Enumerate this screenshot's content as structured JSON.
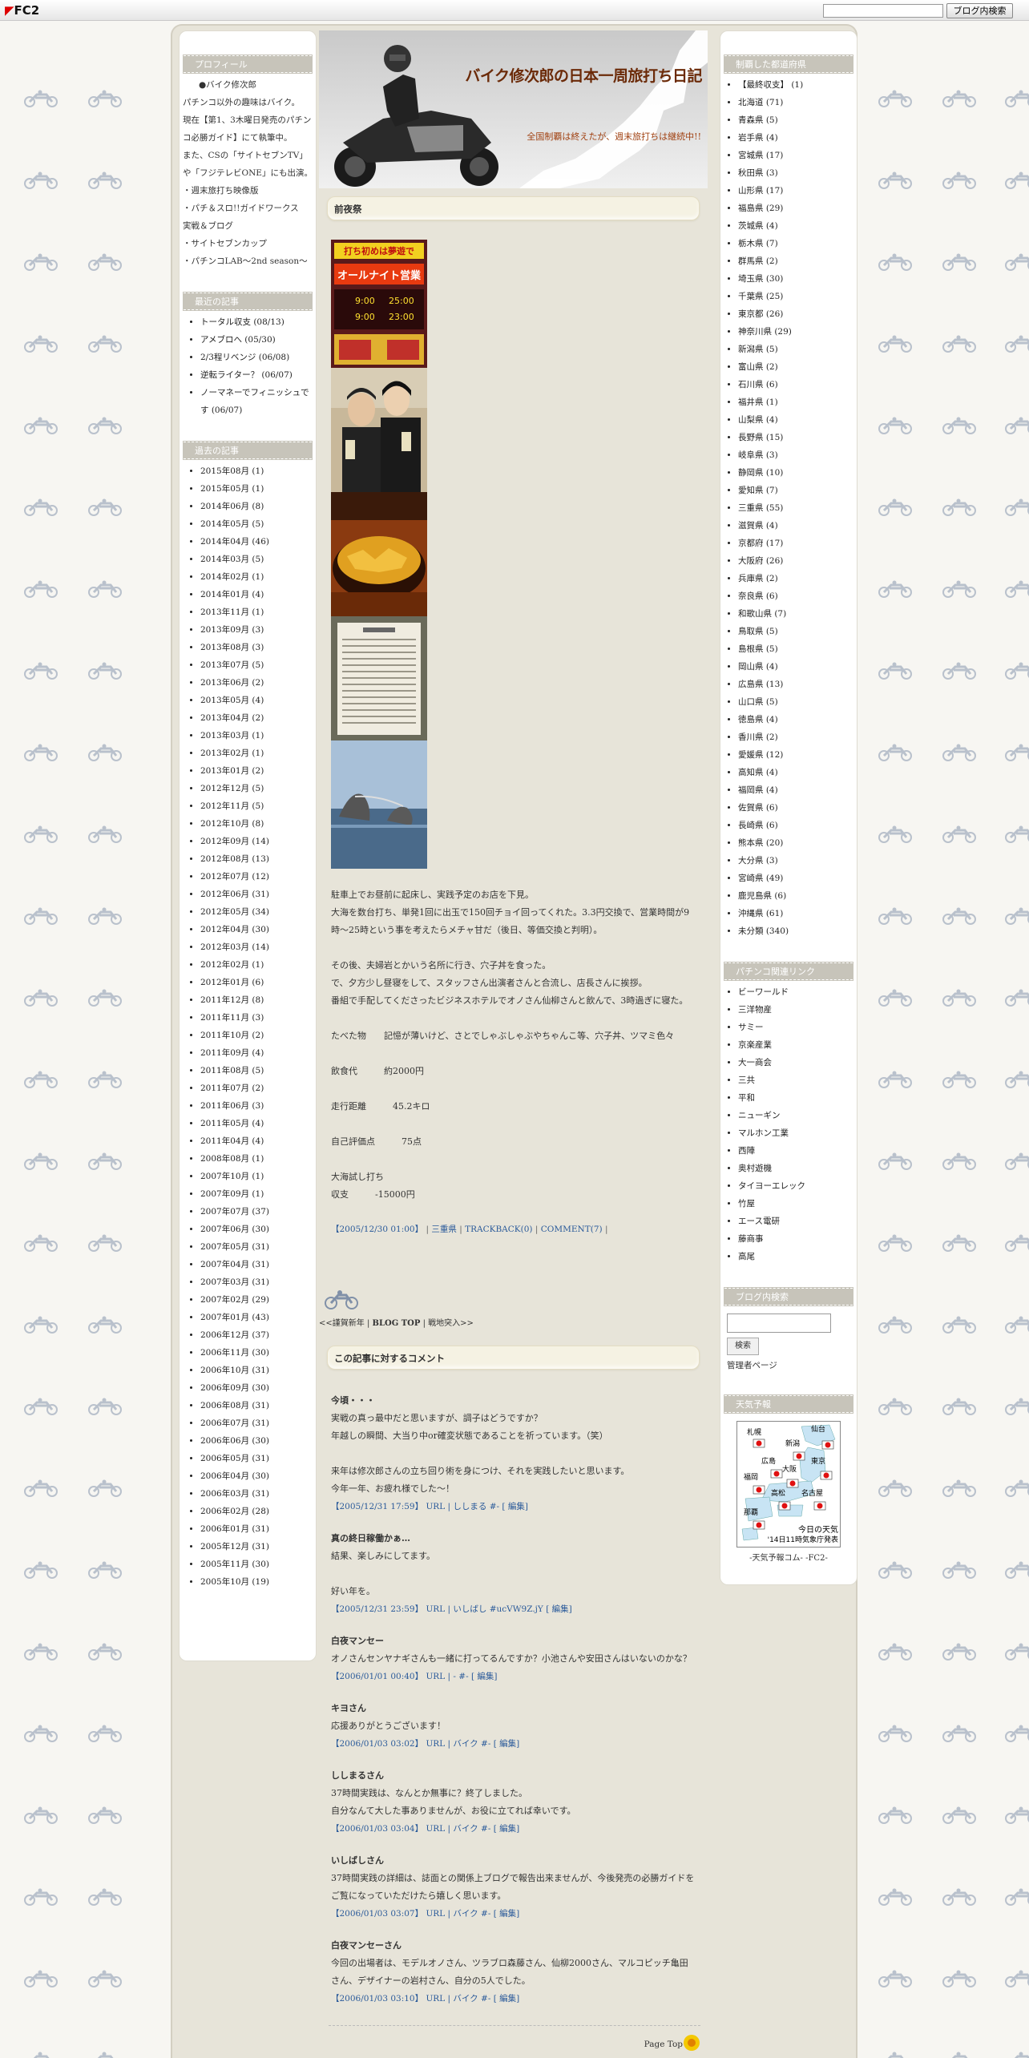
{
  "fc2bar": {
    "logo": "FC2",
    "search_button": "ブログ内検索"
  },
  "banner": {
    "title": "バイク修次郎の日本一周旅打ち日記",
    "subtitle": "全国制覇は終えたが、週末旅打ちは継続中!!"
  },
  "profile": {
    "heading": "プロフィール",
    "name": "●バイク修次郎",
    "lines": [
      "パチンコ以外の趣味はバイク。",
      "現在【第1、3木曜日発売のパチンコ必勝ガイド】にて執筆中。",
      "また、CSの「サイトセブンTV」や「フジテレビONE」にも出演。",
      "・週末旅打ち映像版",
      "・パチ＆スロ!!ガイドワークス　実戦＆ブログ",
      "・サイトセブンカップ",
      "・パチンコLAB～2nd season～"
    ]
  },
  "recent": {
    "heading": "最近の記事",
    "items": [
      "トータル収支 (08/13)",
      "アメブロへ (05/30)",
      "2/3程リベンジ (06/08)",
      "逆転ライター？ (06/07)",
      "ノーマネーでフィニッシュです (06/07)"
    ]
  },
  "archives": {
    "heading": "過去の記事",
    "items": [
      "2015年08月 (1)",
      "2015年05月 (1)",
      "2014年06月 (8)",
      "2014年05月 (5)",
      "2014年04月 (46)",
      "2014年03月 (5)",
      "2014年02月 (1)",
      "2014年01月 (4)",
      "2013年11月 (1)",
      "2013年09月 (3)",
      "2013年08月 (3)",
      "2013年07月 (5)",
      "2013年06月 (2)",
      "2013年05月 (4)",
      "2013年04月 (2)",
      "2013年03月 (1)",
      "2013年02月 (1)",
      "2013年01月 (2)",
      "2012年12月 (5)",
      "2012年11月 (5)",
      "2012年10月 (8)",
      "2012年09月 (14)",
      "2012年08月 (13)",
      "2012年07月 (12)",
      "2012年06月 (31)",
      "2012年05月 (34)",
      "2012年04月 (30)",
      "2012年03月 (14)",
      "2012年02月 (1)",
      "2012年01月 (6)",
      "2011年12月 (8)",
      "2011年11月 (3)",
      "2011年10月 (2)",
      "2011年09月 (4)",
      "2011年08月 (5)",
      "2011年07月 (2)",
      "2011年06月 (3)",
      "2011年05月 (4)",
      "2011年04月 (4)",
      "2008年08月 (1)",
      "2007年10月 (1)",
      "2007年09月 (1)",
      "2007年07月 (37)",
      "2007年06月 (30)",
      "2007年05月 (31)",
      "2007年04月 (31)",
      "2007年03月 (31)",
      "2007年02月 (29)",
      "2007年01月 (43)",
      "2006年12月 (37)",
      "2006年11月 (30)",
      "2006年10月 (31)",
      "2006年09月 (30)",
      "2006年08月 (31)",
      "2006年07月 (31)",
      "2006年06月 (30)",
      "2006年05月 (31)",
      "2006年04月 (30)",
      "2006年03月 (31)",
      "2006年02月 (28)",
      "2006年01月 (31)",
      "2005年12月 (31)",
      "2005年11月 (30)",
      "2005年10月 (19)"
    ]
  },
  "entry": {
    "title": "前夜祭",
    "body": [
      "駐車上でお昼前に起床し、実践予定のお店を下見。",
      "大海を数台打ち、単発1回に出玉で150回チョイ回ってくれた。3.3円交換で、営業時間が9時～25時という事を考えたらメチャ甘だ（後日、等価交換と判明）。",
      "",
      "その後、夫婦岩とかいう名所に行き、穴子丼を食った。",
      "で、夕方少し昼寝をして、スタッフさん出演者さんと合流し、店長さんに挨拶。",
      "番組で手配してくださったビジネスホテルでオノさん仙柳さんと飲んで、3時過ぎに寝た。",
      "",
      "たべた物　　記憶が薄いけど、さとでしゃぶしゃぶやちゃんこ等、穴子丼、ツマミ色々",
      "",
      "飲食代　　　約2000円",
      "",
      "走行距離　　　45.2キロ",
      "",
      "自己評価点　　　75点",
      "",
      "大海試し打ち",
      "収支　　　-15000円"
    ],
    "date": "【2005/12/30 01:00】",
    "category": "三重県",
    "trackback": "TRACKBACK(0)",
    "comment": "COMMENT(7)"
  },
  "photo_sign": {
    "line1": "打ち初めは夢遊で",
    "line2": "オールナイト営業",
    "t1": "9:00",
    "t2": "25:00",
    "t3": "9:00",
    "t4": "23:00"
  },
  "pager": {
    "prev": "謹賀新年",
    "top": "BLOG TOP",
    "next": "戦地突入"
  },
  "comments_heading": "この記事に対するコメント",
  "comments": [
    {
      "name": "今頃・・・",
      "text": "実戦の真っ最中だと思いますが、調子はどうですか？\n年越しの瞬間、大当り中or確変状態であることを祈っています。（笑）\n\n来年は修次郎さんの立ち回り術を身につけ、それを実践したいと思います。\n今年一年、お疲れ様でした～！",
      "foot": "【2005/12/31 17:59】 URL | ししまる #- [ 編集]"
    },
    {
      "name": "真の終日稼働かぁ…",
      "text": "結果、楽しみにしてます。\n\n好い年を。",
      "foot": "【2005/12/31 23:59】 URL | いしばし #ucVW9Z.jY [ 編集]"
    },
    {
      "name": "白夜マンセー",
      "text": "オノさんセンヤナギさんも一緒に打ってるんですか？小池さんや安田さんはいないのかな？",
      "foot": "【2006/01/01 00:40】 URL | - #- [ 編集]"
    },
    {
      "name": "キヨさん",
      "text": "応援ありがとうございます！",
      "foot": "【2006/01/03 03:02】 URL | バイク #- [ 編集]"
    },
    {
      "name": "ししまるさん",
      "text": "37時間実践は、なんとか無事に？終了しました。\n自分なんて大した事ありませんが、お役に立てれば幸いです。",
      "foot": "【2006/01/03 03:04】 URL | バイク #- [ 編集]"
    },
    {
      "name": "いしばしさん",
      "text": "37時間実践の詳細は、誌面との関係上ブログで報告出来ませんが、今後発売の必勝ガイドをご覧になっていただけたら嬉しく思います。",
      "foot": "【2006/01/03 03:07】 URL | バイク #- [ 編集]"
    },
    {
      "name": "白夜マンセーさん",
      "text": "今回の出場者は、モデルオノさん、ツラブロ森藤さん、仙柳2000さん、マルコピッチ亀田さん、デザイナーの岩村さん、自分の5人でした。",
      "foot": "【2006/01/03 03:10】 URL | バイク #- [ 編集]"
    }
  ],
  "pagetop": "Page Top",
  "prefectures": {
    "heading": "制覇した都道府県",
    "items": [
      "【最終収支】 (1)",
      "北海道 (71)",
      "青森県 (5)",
      "岩手県 (4)",
      "宮城県 (17)",
      "秋田県 (3)",
      "山形県 (17)",
      "福島県 (29)",
      "茨城県 (4)",
      "栃木県 (7)",
      "群馬県 (2)",
      "埼玉県 (30)",
      "千葉県 (25)",
      "東京都 (26)",
      "神奈川県 (29)",
      "新潟県 (5)",
      "富山県 (2)",
      "石川県 (6)",
      "福井県 (1)",
      "山梨県 (4)",
      "長野県 (15)",
      "岐阜県 (3)",
      "静岡県 (10)",
      "愛知県 (7)",
      "三重県 (55)",
      "滋賀県 (4)",
      "京都府 (17)",
      "大阪府 (26)",
      "兵庫県 (2)",
      "奈良県 (6)",
      "和歌山県 (7)",
      "鳥取県 (5)",
      "島根県 (5)",
      "岡山県 (4)",
      "広島県 (13)",
      "山口県 (5)",
      "徳島県 (4)",
      "香川県 (2)",
      "愛媛県 (12)",
      "高知県 (4)",
      "福岡県 (4)",
      "佐賀県 (6)",
      "長崎県 (6)",
      "熊本県 (20)",
      "大分県 (3)",
      "宮崎県 (49)",
      "鹿児島県 (6)",
      "沖縄県 (61)",
      "未分類 (340)"
    ]
  },
  "links": {
    "heading": "パチンコ関連リンク",
    "items": [
      "ビーワールド",
      "三洋物産",
      "サミー",
      "京楽産業",
      "大一商会",
      "三共",
      "平和",
      "ニューギン",
      "マルホン工業",
      "西陣",
      "奥村遊機",
      "タイヨーエレック",
      "竹屋",
      "エース電研",
      "藤商事",
      "高尾"
    ]
  },
  "blogsearch": {
    "heading": "ブログ内検索",
    "button": "検索",
    "admin": "管理者ページ"
  },
  "weather": {
    "heading": "天気予報",
    "cities": [
      "札幌",
      "仙台",
      "新潟",
      "東京",
      "広島",
      "大阪",
      "福岡",
      "名古屋",
      "高松",
      "那覇"
    ],
    "caption1": "今日の天気",
    "caption2": "'14日11時気象庁発表",
    "footer": "-天気予報コム- -FC2-"
  }
}
